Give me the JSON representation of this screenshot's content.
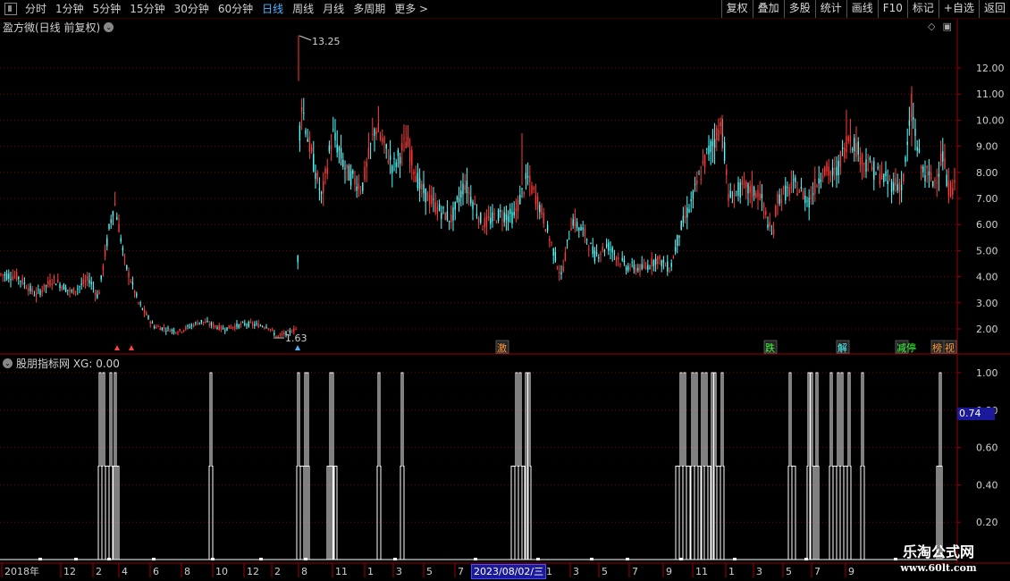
{
  "toolbar": {
    "periods": [
      "分时",
      "1分钟",
      "5分钟",
      "15分钟",
      "30分钟",
      "60分钟",
      "日线",
      "周线",
      "月线",
      "多周期",
      "更多 >"
    ],
    "active_period": "日线",
    "right_buttons": [
      "复权",
      "叠加",
      "多股",
      "统计",
      "画线",
      "F10",
      "标记",
      "+自选",
      "返回"
    ]
  },
  "main_panel": {
    "title": "盈方微(日线 前复权)",
    "price_axis": [
      "12.00",
      "11.00",
      "10.00",
      "9.00",
      "8.00",
      "7.00",
      "6.00",
      "5.00",
      "4.00",
      "3.00",
      "2.00"
    ],
    "high_label": "13.25",
    "low_label": "1.63",
    "event_tags": [
      "激",
      "跌",
      "解",
      "减停",
      "榜",
      "视"
    ]
  },
  "indicator_panel": {
    "title": "股朋指标网 XG: 0.00",
    "axis": [
      "1.00",
      "0.80",
      "0.60",
      "0.40",
      "0.20"
    ],
    "cursor_value": "0.74"
  },
  "time_axis": {
    "labels": [
      "2018年",
      "12",
      "2",
      "4",
      "6",
      "8",
      "10",
      "12",
      "2",
      "8",
      "11",
      "1",
      "3",
      "5",
      "7",
      "1",
      "3",
      "5",
      "7",
      "9",
      "11",
      "1",
      "3",
      "5",
      "7",
      "9"
    ],
    "cursor_date": "2023/08/02/三"
  },
  "watermark": {
    "line1": "乐淘公式网",
    "line2": "www.60lt.com"
  },
  "colors": {
    "up": "#ff3c3c",
    "down": "#54ffff",
    "grid": "#7a0000",
    "active": "#4fb3ff"
  }
}
